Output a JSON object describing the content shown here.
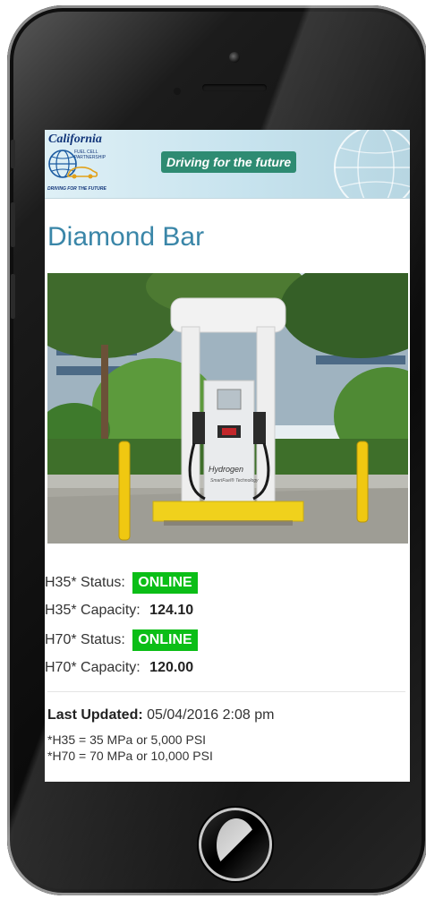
{
  "banner": {
    "logo_title": "California",
    "logo_subtitle": "FUEL CELL PARTNERSHIP",
    "logo_tagline": "DRIVING FOR THE FUTURE",
    "tagline": "Driving for the future"
  },
  "station": {
    "title": "Diamond Bar",
    "photo_alt": "Hydrogen fuel dispenser",
    "dispenser_text": "Hydrogen",
    "dispenser_subtext": "SmartFuel® Technology"
  },
  "status": {
    "h35_status_label": "H35* Status:",
    "h35_status_value": "ONLINE",
    "h35_capacity_label": "H35* Capacity:",
    "h35_capacity_value": "124.10",
    "h70_status_label": "H70* Status:",
    "h70_status_value": "ONLINE",
    "h70_capacity_label": "H70* Capacity:",
    "h70_capacity_value": "120.00",
    "status_color": "#0bbe17"
  },
  "footer": {
    "last_updated_label": "Last Updated:",
    "last_updated_value": "05/04/2016 2:08 pm",
    "note_h35": "*H35 = 35 MPa or 5,000 PSI",
    "note_h70": "*H70 = 70 MPa or 10,000 PSI"
  },
  "colors": {
    "title": "#3a86a8",
    "tagline_bg": "#2e8b72"
  }
}
